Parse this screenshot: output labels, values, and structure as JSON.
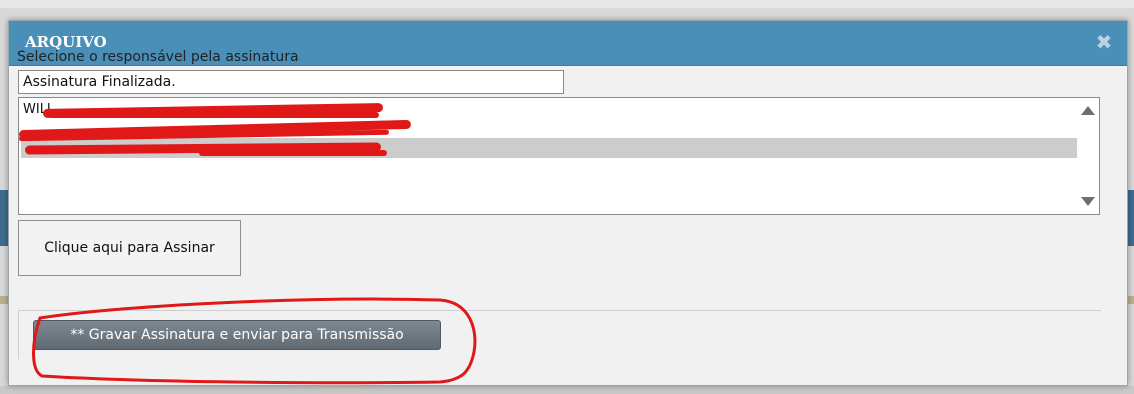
{
  "dialog": {
    "title": "ARQUIVO",
    "close_symbol": "✖",
    "select_label": "Selecione o responsável pela assinatura",
    "status_value": "Assinatura Finalizada.",
    "list_items": [
      {
        "text": "WILL",
        "selected": false
      },
      {
        "text": "",
        "selected": false
      },
      {
        "text": "",
        "selected": true
      }
    ],
    "sign_button_label": "Clique aqui para Assinar",
    "save_button_label": "** Gravar Assinatura e enviar para Transmissão"
  },
  "colors": {
    "titlebar": "#4a8fb8",
    "annotation": "#e01818",
    "save_button": "#6b767e"
  },
  "icons": {
    "close": "close-icon",
    "scroll_up": "arrow-up-icon",
    "scroll_down": "arrow-down-icon"
  }
}
